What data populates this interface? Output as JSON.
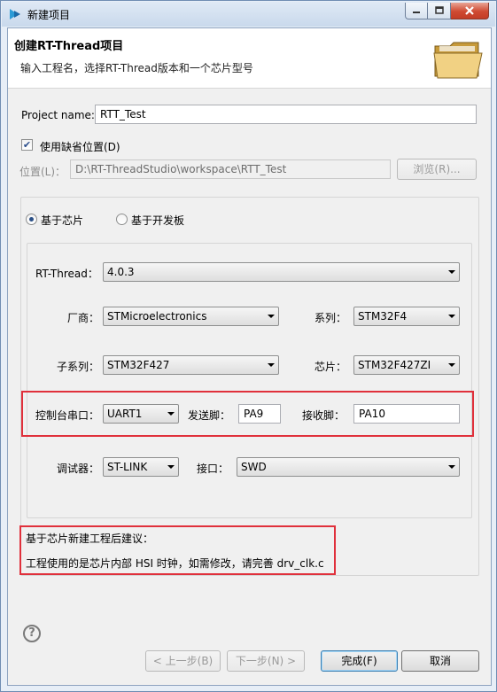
{
  "window": {
    "title": "新建项目"
  },
  "banner": {
    "title": "创建RT-Thread项目",
    "description": "输入工程名，选择RT-Thread版本和一个芯片型号"
  },
  "project": {
    "name_label": "Project name:",
    "name_value": "RTT_Test",
    "default_location_label": "使用缺省位置(D)",
    "default_location_checked": true,
    "location_label": "位置(L)：",
    "location_value": "D:\\RT-ThreadStudio\\workspace\\RTT_Test",
    "browse_label": "浏览(R)..."
  },
  "mode": {
    "chip_label": "基于芯片",
    "board_label": "基于开发板",
    "selected": "chip"
  },
  "config": {
    "rtthread_label": "RT-Thread：",
    "rtthread_value": "4.0.3",
    "vendor_label": "厂商：",
    "vendor_value": "STMicroelectronics",
    "series_label": "系列：",
    "series_value": "STM32F4",
    "subseries_label": "子系列：",
    "subseries_value": "STM32F427",
    "chip_label": "芯片：",
    "chip_value": "STM32F427ZI",
    "console_label": "控制台串口：",
    "console_value": "UART1",
    "tx_label": "发送脚：",
    "tx_value": "PA9",
    "rx_label": "接收脚：",
    "rx_value": "PA10",
    "debugger_label": "调试器：",
    "debugger_value": "ST-LINK",
    "interface_label": "接口：",
    "interface_value": "SWD"
  },
  "advice": {
    "title": "基于芯片新建工程后建议：",
    "text": "工程使用的是芯片内部 HSI 时钟，如需修改，请完善 drv_clk.c"
  },
  "footer": {
    "help_glyph": "?",
    "back_label": "< 上一步(B)",
    "next_label": "下一步(N) >",
    "finish_label": "完成(F)",
    "cancel_label": "取消"
  },
  "colors": {
    "highlight_red": "#e0303b",
    "window_border": "#6f8db3"
  }
}
